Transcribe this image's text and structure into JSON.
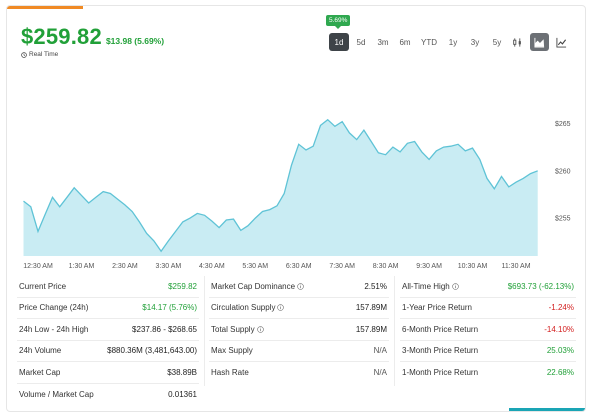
{
  "header": {
    "price": "$259.82",
    "change": "$13.98 (5.69%)",
    "realtime_label": "Real Time"
  },
  "tooltip": {
    "label": "5.69%"
  },
  "ranges": [
    {
      "label": "1d",
      "active": true
    },
    {
      "label": "5d",
      "active": false
    },
    {
      "label": "3m",
      "active": false
    },
    {
      "label": "6m",
      "active": false
    },
    {
      "label": "YTD",
      "active": false
    },
    {
      "label": "1y",
      "active": false
    },
    {
      "label": "3y",
      "active": false
    },
    {
      "label": "5y",
      "active": false
    }
  ],
  "view_buttons": [
    {
      "icon": "candlestick-icon",
      "active": false
    },
    {
      "icon": "area-chart-icon",
      "active": true
    },
    {
      "icon": "line-chart-icon",
      "active": false
    }
  ],
  "colors": {
    "accent_green": "#21a038",
    "negative_red": "#d32020",
    "area_fill": "#bfe9f1",
    "line": "#5fc3d6"
  },
  "chart_data": {
    "type": "area",
    "y_ticks": [
      "$265",
      "$260",
      "$255"
    ],
    "y_tick_values": [
      265,
      260,
      255
    ],
    "x_ticks": [
      "12:30 AM",
      "1:30 AM",
      "2:30 AM",
      "3:30 AM",
      "4:30 AM",
      "5:30 AM",
      "6:30 AM",
      "7:30 AM",
      "8:30 AM",
      "9:30 AM",
      "10:30 AM",
      "11:30 AM"
    ],
    "x": [
      "12:10",
      "12:20",
      "12:30",
      "12:40",
      "12:50",
      "1:00",
      "1:10",
      "1:20",
      "1:30",
      "1:40",
      "1:50",
      "2:00",
      "2:10",
      "2:20",
      "2:30",
      "2:40",
      "2:50",
      "3:00",
      "3:10",
      "3:20",
      "3:30",
      "3:40",
      "3:50",
      "4:00",
      "4:10",
      "4:20",
      "4:30",
      "4:40",
      "4:50",
      "5:00",
      "5:10",
      "5:20",
      "5:30",
      "5:40",
      "5:50",
      "6:00",
      "6:10",
      "6:20",
      "6:30",
      "6:40",
      "6:50",
      "7:00",
      "7:10",
      "7:20",
      "7:30",
      "7:40",
      "7:50",
      "8:00",
      "8:10",
      "8:20",
      "8:30",
      "8:40",
      "8:50",
      "9:00",
      "9:10",
      "9:20",
      "9:30",
      "9:40",
      "9:50",
      "10:00",
      "10:10",
      "10:20",
      "10:30",
      "10:40",
      "10:50",
      "11:00",
      "11:10",
      "11:20",
      "11:30",
      "11:40",
      "11:50",
      "12:00"
    ],
    "y": [
      256.8,
      256.2,
      253.6,
      255.4,
      257.2,
      256.2,
      257.2,
      258.2,
      257.4,
      256.6,
      257.2,
      257.8,
      257.6,
      257.0,
      256.4,
      255.7,
      254.6,
      253.4,
      252.6,
      251.5,
      252.6,
      253.6,
      254.6,
      255.0,
      255.5,
      255.3,
      254.7,
      254.0,
      254.8,
      254.9,
      253.7,
      254.2,
      255.0,
      255.7,
      255.9,
      256.3,
      257.6,
      260.6,
      262.8,
      262.2,
      262.6,
      264.8,
      265.4,
      264.7,
      265.2,
      264.0,
      263.3,
      264.3,
      263.1,
      261.9,
      261.7,
      262.5,
      262.0,
      262.9,
      263.1,
      262.0,
      261.2,
      262.1,
      262.5,
      262.6,
      262.8,
      262.1,
      262.4,
      261.2,
      259.2,
      258.1,
      259.4,
      258.3,
      258.8,
      259.2,
      259.7,
      260.0
    ],
    "xlabel": "",
    "ylabel": "",
    "grid": false
  },
  "stats": {
    "col1": [
      {
        "label": "Current Price",
        "value": "$259.82",
        "tone": "pos"
      },
      {
        "label": "Price Change (24h)",
        "value": "$14.17 (5.76%)",
        "tone": "pos"
      },
      {
        "label": "24h Low - 24h High",
        "value": "$237.86 - $268.65",
        "tone": ""
      },
      {
        "label": "24h Volume",
        "value": "$880.36M (3,481,643.00)",
        "tone": ""
      },
      {
        "label": "Market Cap",
        "value": "$38.89B",
        "tone": ""
      },
      {
        "label": "Volume / Market Cap",
        "value": "0.01361",
        "tone": ""
      }
    ],
    "col2": [
      {
        "label": "Market Cap Dominance",
        "value": "2.51%",
        "tone": "",
        "info": true
      },
      {
        "label": "Circulation Supply",
        "value": "157.89M",
        "tone": "",
        "info": true
      },
      {
        "label": "Total Supply",
        "value": "157.89M",
        "tone": "",
        "info": true
      },
      {
        "label": "Max Supply",
        "value": "N/A",
        "tone": "muted",
        "info": false
      },
      {
        "label": "Hash Rate",
        "value": "N/A",
        "tone": "muted",
        "info": false
      }
    ],
    "col3": [
      {
        "label": "All-Time High",
        "value": "$693.73 (-62.13%)",
        "tone": "pos",
        "info": true
      },
      {
        "label": "1-Year Price Return",
        "value": "-1.24%",
        "tone": "neg",
        "info": false
      },
      {
        "label": "6-Month Price Return",
        "value": "-14.10%",
        "tone": "neg",
        "info": false
      },
      {
        "label": "3-Month Price Return",
        "value": "25.03%",
        "tone": "pos",
        "info": false
      },
      {
        "label": "1-Month Price Return",
        "value": "22.68%",
        "tone": "pos",
        "info": false
      }
    ]
  }
}
